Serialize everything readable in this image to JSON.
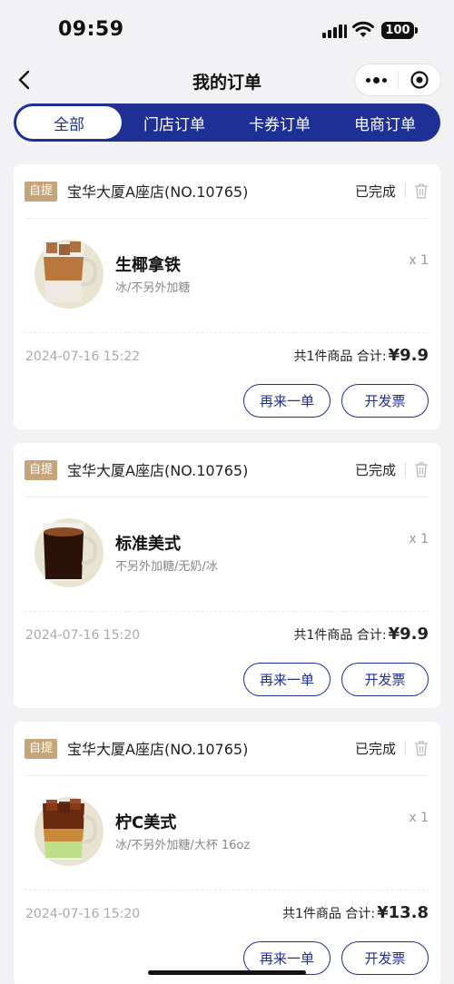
{
  "status_bar": {
    "time": "09:59",
    "battery": "100"
  },
  "nav": {
    "title": "我的订单"
  },
  "tabs": [
    {
      "label": "全部",
      "active": true
    },
    {
      "label": "门店订单",
      "active": false
    },
    {
      "label": "卡券订单",
      "active": false
    },
    {
      "label": "电商订单",
      "active": false
    }
  ],
  "orders": [
    {
      "tag": "自提",
      "store": "宝华大厦A座店(NO.10765)",
      "status": "已完成",
      "product": {
        "name": "生椰拿铁",
        "spec": "冰/不另外加糖",
        "qty": "x 1",
        "image": "iced-coconut-latte"
      },
      "date": "2024-07-16 15:22",
      "summary": "共1件商品 合计:",
      "price": "¥9.9",
      "reorder_label": "再来一单",
      "invoice_label": "开发票"
    },
    {
      "tag": "自提",
      "store": "宝华大厦A座店(NO.10765)",
      "status": "已完成",
      "product": {
        "name": "标准美式",
        "spec": "不另外加糖/无奶/冰",
        "qty": "x 1",
        "image": "americano"
      },
      "date": "2024-07-16 15:20",
      "summary": "共1件商品 合计:",
      "price": "¥9.9",
      "reorder_label": "再来一单",
      "invoice_label": "开发票"
    },
    {
      "tag": "自提",
      "store": "宝华大厦A座店(NO.10765)",
      "status": "已完成",
      "product": {
        "name": "柠C美式",
        "spec": "冰/不另外加糖/大杯 16oz",
        "qty": "x 1",
        "image": "lemon-americano"
      },
      "date": "2024-07-16 15:20",
      "summary": "共1件商品 合计:",
      "price": "¥13.8",
      "reorder_label": "再来一单",
      "invoice_label": "开发票"
    }
  ],
  "colors": {
    "primary": "#1e2f96",
    "tag": "#c7a57a",
    "background": "#f2f2f4"
  },
  "icons": [
    "back-icon",
    "more-icon",
    "target-icon",
    "trash-icon",
    "signal-icon",
    "wifi-icon",
    "battery-icon"
  ]
}
